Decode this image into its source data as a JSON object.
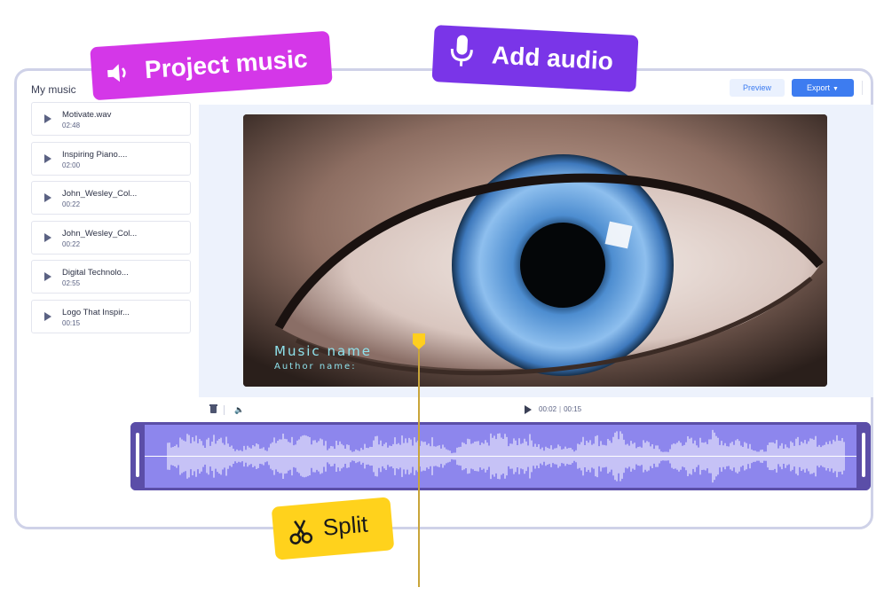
{
  "sidebar": {
    "title": "My music",
    "tracks": [
      {
        "name": "Motivate.wav",
        "duration": "02:48"
      },
      {
        "name": "Inspiring Piano....",
        "duration": "02:00"
      },
      {
        "name": "John_Wesley_Col...",
        "duration": "00:22"
      },
      {
        "name": "John_Wesley_Col...",
        "duration": "00:22"
      },
      {
        "name": "Digital Technolo...",
        "duration": "02:55"
      },
      {
        "name": "Logo That Inspir...",
        "duration": "00:15"
      }
    ]
  },
  "toolbar": {
    "preview_label": "Preview",
    "export_label": "Export"
  },
  "video": {
    "title": "Music name",
    "author": "Author name:"
  },
  "player": {
    "current_time": "00:02",
    "total_time": "00:15"
  },
  "labels": {
    "project_music": "Project music",
    "add_audio": "Add audio",
    "split": "Split"
  },
  "colors": {
    "project_music_label": "#d437e8",
    "add_audio_label": "#7a35e8",
    "split_label": "#ffd21c",
    "waveform_fill": "#8d86ed",
    "waveform_border": "#5b4ea8",
    "accent": "#3d7cf0"
  },
  "icons": {
    "project_music": "speaker-icon",
    "add_audio": "microphone-icon",
    "split": "scissors-icon"
  }
}
